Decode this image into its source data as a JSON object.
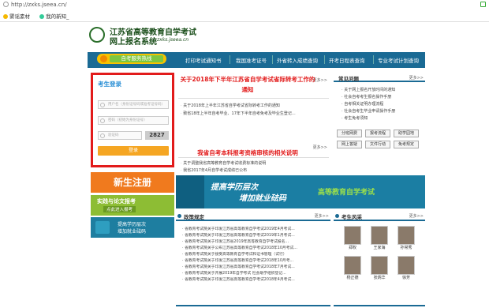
{
  "browser": {
    "url": "http://zxks.jseea.cn/",
    "bookmarks": [
      "雾谣素材",
      "我的新知_"
    ]
  },
  "header": {
    "line1": "江苏省高等教育自学考试",
    "line2": "网上报名系统",
    "domain": "zxks.jseea.cn"
  },
  "nav": {
    "hotline": "自考服务热线",
    "items": [
      "打印考试通知书",
      "我国准考证号",
      "外省转入成绩查询",
      "开考日程表查询",
      "专业考试计划查询"
    ]
  },
  "login": {
    "title": "考生登录",
    "user_placeholder": "用户名（身份证号码或准考证号码）",
    "pass_placeholder": "密码（初始为身份证号）",
    "captcha_placeholder": "验证码",
    "captcha": "2827",
    "submit": "登录"
  },
  "side": {
    "register": "新生注册",
    "practice": "实践与论文报考",
    "practice_sub": "点此进入报考",
    "promo_a": "提高学历层次",
    "promo_b": "增加就业砝码"
  },
  "news": {
    "more": "更多>>",
    "headline1": "关于2018年下半年江苏省自学考试省际转考工作的通知",
    "items1": [
      "关于2018年上半年江苏省自学考试省际转考工作的通知",
      "致省18年上半年自考毕业、17年下半年自考免考及毕业生登记..."
    ],
    "headline2": "我省自考本科报考资格审核的相关说明",
    "items2": [
      "关于调整我省高等教育自学考试收费标准的说明",
      "我省2017年4月自学考试成绩已公布"
    ]
  },
  "faq": {
    "title": "常见问题",
    "more": "更多>>",
    "items": [
      "关于网上报名开放时间的通知",
      "社会自考考生报名操作手册",
      "自考相关证明办理流程",
      "社会自考生毕业申请操作手册",
      "考生免考须知"
    ],
    "buttons": [
      "分班网费",
      "报考流程",
      "助学园地",
      "网上答疑",
      "文件行动",
      "免考规定"
    ]
  },
  "banner": {
    "line1": "提高学历层次",
    "line2": "增加就业砝码",
    "slogan": "高等教育自学考试"
  },
  "policy": {
    "title": "政策规定",
    "more": "更多>>",
    "items": [
      "省教育考试院关于印发江苏省高等教育自学考试2019年4月考试...",
      "省教育考试院关于印发江苏省高等教育自学考试2019年1月考试...",
      "省教育考试院关于印发江苏省2019年高等教育自学考试报名...",
      "省教育考试院关于公布江苏省高等教育自学考试2018年10月考试...",
      "省教育考试院关于接受高等教育自学考试和证书管理（试行）",
      "省教育考试院关于印发江苏省高等教育自学考试2018年10月考...",
      "省教育考试院关于印发江苏省高等教育自学考试2018年7月考试...",
      "省教育考试院关于开展2019年自学考试 社会助学组织登记...",
      "省教育考试院关于印发江苏省高等教育自学考试2018年4月考试..."
    ]
  },
  "stars": {
    "title": "考生风采",
    "more": "更多>>",
    "people": [
      "郑权",
      "王家海",
      "孙常秀",
      "杨正德",
      "张炳华",
      "徐芳"
    ]
  }
}
